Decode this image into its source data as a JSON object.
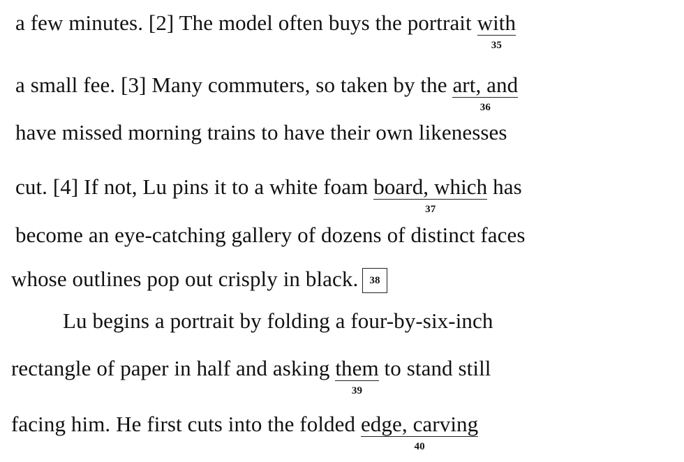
{
  "passage": {
    "line1": {
      "before": "a few minutes. [2] The model often buys the portrait ",
      "underlined": "with",
      "num": "35"
    },
    "line2": {
      "before": "a small fee. [3] Many commuters, so taken by the ",
      "underlined": "art, and",
      "num": "36"
    },
    "line3": {
      "text": "have missed morning trains to have their own likenesses"
    },
    "line4": {
      "before": "cut. [4] If not, Lu pins it to a white foam ",
      "underlined": "board, which",
      "after": " has",
      "num": "37"
    },
    "line5": {
      "text": "become an eye-catching gallery of dozens of distinct faces"
    },
    "line6": {
      "text": "whose outlines pop out crisply in black.",
      "box": "38"
    },
    "line7": {
      "text": "Lu begins a portrait by folding a four-by-six-inch"
    },
    "line8": {
      "before": "rectangle of paper in half and asking ",
      "underlined": "them",
      "after": " to stand still",
      "num": "39"
    },
    "line9": {
      "before": "facing him. He first cuts into the folded ",
      "underlined": "edge, carving",
      "num": "40"
    }
  }
}
